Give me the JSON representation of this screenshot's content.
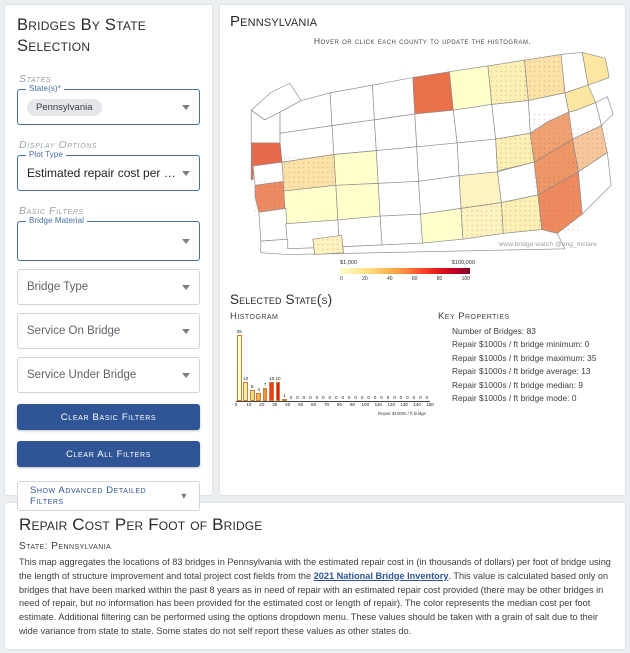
{
  "sidebar": {
    "title": "Bridges By State Selection",
    "groups": {
      "states": "States",
      "display_options": "Display Options",
      "basic_filters": "Basic Filters"
    },
    "state_field": {
      "legend": "State(s)*",
      "chip": "Pennsylvania"
    },
    "plot_type_field": {
      "legend": "Plot Type",
      "value": "Estimated repair cost per foot of bri..."
    },
    "bridge_material_field": {
      "legend": "Bridge Material",
      "value": ""
    },
    "bridge_type_field": {
      "value": "Bridge Type"
    },
    "service_on_field": {
      "value": "Service On Bridge"
    },
    "service_under_field": {
      "value": "Service Under Bridge"
    },
    "clear_basic_label": "Clear Basic Filters",
    "clear_all_label": "Clear All Filters",
    "advanced_label": "Show Advanced Detailed Filters",
    "advanced_chevron": "chevron-down-icon"
  },
  "map": {
    "title": "Pennsylvania",
    "subtitle": "Hover or click each county to update the histogram.",
    "watermark": "www.bridge.watch @eng_mclare",
    "colorbar": {
      "left_label": "$1,000",
      "right_label": "$100,000",
      "ticks": [
        "0",
        "20",
        "40",
        "60",
        "80",
        "100"
      ]
    }
  },
  "selected": {
    "title": "Selected State(s)",
    "histogram_heading": "Histogram",
    "key_properties_heading": "Key Properties",
    "key_properties": [
      "Number of Bridges: 83",
      "Repair $1000s / ft bridge minimum: 0",
      "Repair $1000s / ft bridge maximum: 35",
      "Repair $1000s / ft bridge average: 13",
      "Repair $1000s / ft bridge median: 9",
      "Repair $1000s / ft bridge mode: 0"
    ]
  },
  "chart_data": {
    "type": "bar",
    "title": "Histogram",
    "xlabel": "Repair $1000s / ft bridge",
    "ylabel": "",
    "xlim": [
      0,
      150
    ],
    "ylim": [
      0,
      35
    ],
    "xticks": [
      0,
      10,
      20,
      30,
      40,
      50,
      60,
      70,
      80,
      90,
      100,
      110,
      120,
      130,
      140,
      150
    ],
    "grid": false,
    "bin_width": 5,
    "bin_starts": [
      0,
      5,
      10,
      15,
      20,
      25,
      30,
      35,
      40,
      45,
      50,
      55,
      60,
      65,
      70,
      75,
      80,
      85,
      90,
      95,
      100,
      105,
      110,
      115,
      120,
      125,
      130,
      135,
      140,
      145
    ],
    "values": [
      35,
      10,
      6,
      4,
      7,
      10,
      10,
      1,
      0,
      0,
      0,
      0,
      0,
      0,
      0,
      0,
      0,
      0,
      0,
      0,
      0,
      0,
      0,
      0,
      0,
      0,
      0,
      0,
      0,
      0
    ],
    "bar_colors": [
      "#ffffcc",
      "#ffeda0",
      "#fed976",
      "#feb24c",
      "#fd8d3c",
      "#f03b20",
      "#e31a1c",
      "#bd0026",
      "#cccccc",
      "#cccccc",
      "#cccccc",
      "#cccccc",
      "#cccccc",
      "#cccccc",
      "#cccccc",
      "#cccccc",
      "#cccccc",
      "#cccccc",
      "#cccccc",
      "#cccccc",
      "#cccccc",
      "#cccccc",
      "#cccccc",
      "#cccccc",
      "#cccccc",
      "#cccccc",
      "#cccccc",
      "#cccccc",
      "#cccccc",
      "#cccccc"
    ]
  },
  "bottom": {
    "title": "Repair Cost Per Foot of Bridge",
    "state_line": "State: Pennsylvania",
    "para_1": "This map aggregates the locations of 83 bridges in Pennsylvania with the estimated repair cost in (in thousands of dollars) per foot of bridge using the length of structure improvement and total project cost fields from the ",
    "link": "2021 National Bridge Inventory",
    "para_2": ". This value is calculated based only on bridges that have been marked within the past 8 years as in need of repair with an estimated repair cost provided (there may be other bridges in need of repair, but no information has been provided for the estimated cost or length of repair). The color represents the median cost per foot estimate. Additional filtering can be performed using the options dropdown menu. These values should be taken with a grain of salt due to their wide variance from state to state. Some states do not self report these values as other states do."
  },
  "colors": {
    "brand_blue": "#2f5596",
    "link_blue": "#2f5596",
    "page_bg": "#eceff1"
  }
}
